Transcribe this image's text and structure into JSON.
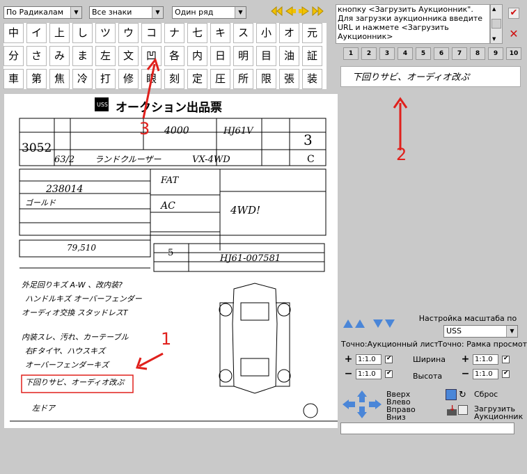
{
  "toolbar": {
    "radical_select": "По Радикалам",
    "signs_select": "Все знаки",
    "row_select": "Один ряд"
  },
  "kanji_rows": [
    [
      "中",
      "イ",
      "上",
      "し",
      "ツ",
      "ウ",
      "コ",
      "ナ",
      "七",
      "キ",
      "ス",
      "小",
      "オ",
      "元"
    ],
    [
      "分",
      "さ",
      "み",
      "ま",
      "左",
      "文",
      "凹",
      "各",
      "内",
      "日",
      "明",
      "目",
      "油",
      "証"
    ],
    [
      "車",
      "第",
      "焦",
      "冷",
      "打",
      "修",
      "眼",
      "刻",
      "定",
      "圧",
      "所",
      "限",
      "張",
      "装"
    ]
  ],
  "info_text": "кнопку <Загрузить Аукционник\". Для загрузки аукционника введите URL и нажмете <Загрузить Аукционник>",
  "page_numbers": [
    "1",
    "2",
    "3",
    "4",
    "5",
    "6",
    "7",
    "8",
    "9",
    "10"
  ],
  "preview_text": "下回りサビ、オーディオ改ぷ",
  "annotations": {
    "one": "1",
    "two": "2",
    "three": "3"
  },
  "sheet": {
    "title": "オークション出品票",
    "lot": "3052",
    "uss": "USS",
    "year": "63",
    "make": "ランドクルーザー",
    "model": "HJ61V",
    "grade": "VX-4WD",
    "cc": "4000",
    "score": "3",
    "interior": "C",
    "mileage": "238014",
    "color": "ゴールド",
    "shift": "FAT",
    "ac": "AC",
    "chassis": "HJ61-007581",
    "seats": "5",
    "recycle": "79,510",
    "sales_point": "4WD!",
    "notes": [
      "外足回りキズ A-W 、改内装?",
      "ハンドルキズ オーバーフェンダー",
      "オーディオ交換 スタッドレスT",
      "内装スレ、汚れ、カーテーブル",
      "右Fタイヤ、ハウスキズ",
      "オーバーフェンダーキズ",
      "下回りサビ、オーディオ改ぷ",
      "左ドア"
    ]
  },
  "scale": {
    "title": "Настройка масштаба по типу листа:",
    "type_value": "USS",
    "precise_sheet": "Точно:Аукционный лист",
    "precise_frame": "Точно: Рамка просмотра",
    "width_label": "Ширина",
    "height_label": "Высота",
    "values": [
      "1:1.0",
      "1:1.0",
      "1:1.0",
      "1:1.0"
    ]
  },
  "nav": {
    "up": "Вверх",
    "left": "Влево",
    "right": "Вправо",
    "down": "Вниз",
    "reset": "Сброс",
    "load": "Загрузить Аукционник"
  }
}
